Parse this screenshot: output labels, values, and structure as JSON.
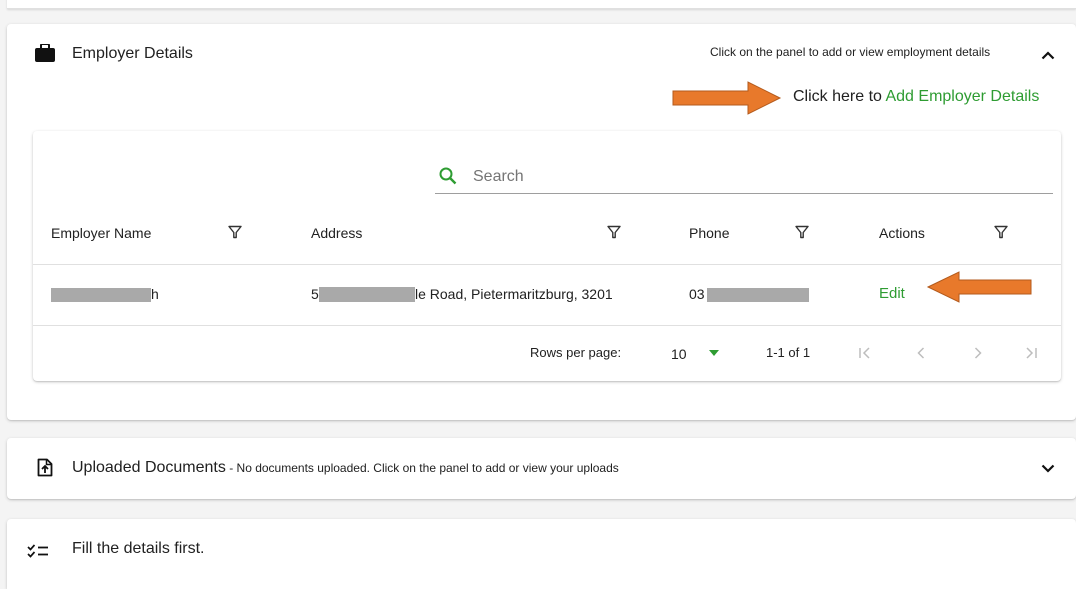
{
  "employer_panel": {
    "title": "Employer Details",
    "hint": "Click on the panel to add or view employment details",
    "add_prefix": "Click here to",
    "add_link": "Add Employer Details"
  },
  "table": {
    "search_placeholder": "Search",
    "columns": [
      "Employer Name",
      "Address",
      "Phone",
      "Actions"
    ],
    "rows": [
      {
        "employer_name_visible": "h",
        "address_visible_start": "56",
        "address_visible_end": "le Road, Pietermaritzburg, 3201",
        "phone_visible": "03",
        "action": "Edit"
      }
    ],
    "footer": {
      "rows_per_page_label": "Rows per page:",
      "rows_per_page_value": "10",
      "range": "1-1 of 1"
    }
  },
  "documents_panel": {
    "title": "Uploaded Documents",
    "subtitle": " - No documents uploaded. Click on the panel to add or view your uploads"
  },
  "fill_panel": {
    "title": "Fill the details first."
  },
  "colors": {
    "accent_green": "#2e9c32",
    "annotation_arrow": "#e8792b",
    "redaction": "#a9a9a9"
  },
  "icons": {
    "employer": "briefcase-icon",
    "collapse": "chevron-up-icon",
    "search": "search-icon",
    "filter": "filter-icon",
    "rows_dropdown": "caret-down-icon",
    "pager_first": "first-page-icon",
    "pager_prev": "prev-page-icon",
    "pager_next": "next-page-icon",
    "pager_last": "last-page-icon",
    "documents": "file-upload-icon",
    "expand": "chevron-down-icon",
    "checklist": "checklist-icon",
    "annotation": "arrow-annotation-icon"
  }
}
